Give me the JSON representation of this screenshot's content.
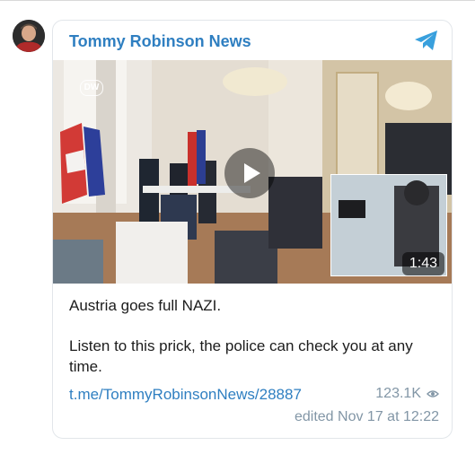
{
  "channel": {
    "name": "Tommy Robinson News"
  },
  "media": {
    "duration": "1:43",
    "watermark": "DW"
  },
  "post": {
    "line1": "Austria goes full NAZI.",
    "line2": "Listen to this prick, the police can check you at any time.",
    "link": "t.me/TommyRobinsonNews/28887",
    "views": "123.1K",
    "edited": "edited  Nov 17 at 12:22"
  },
  "colors": {
    "accent": "#2f7fc1",
    "meta": "#8296a6",
    "border": "#e2e6ea"
  },
  "icons": {
    "brand": "telegram-icon",
    "views": "eye-icon",
    "play": "play-icon"
  }
}
